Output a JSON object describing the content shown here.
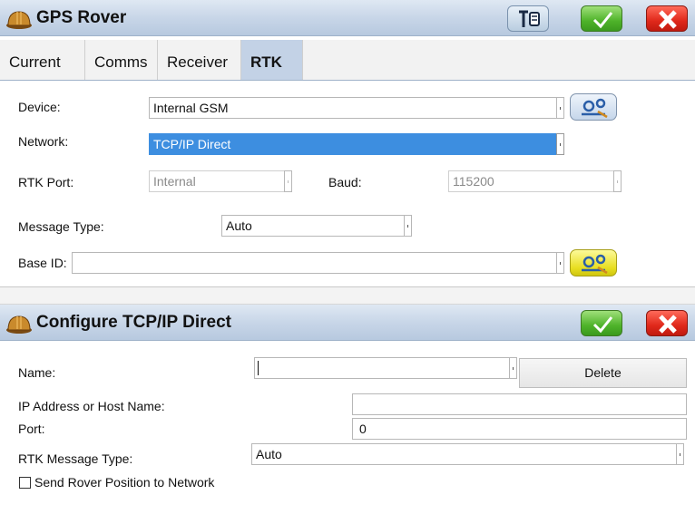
{
  "rover": {
    "title": "GPS Rover",
    "tabs": [
      "Current",
      "Comms",
      "Receiver",
      "RTK"
    ],
    "active_tab": "RTK",
    "device_label": "Device:",
    "device_value": "Internal GSM",
    "network_label": "Network:",
    "network_value": "TCP/IP Direct",
    "rtk_port_label": "RTK Port:",
    "rtk_port_value": "Internal",
    "baud_label": "Baud:",
    "baud_value": "115200",
    "message_type_label": "Message Type:",
    "message_type_value": "Auto",
    "base_id_label": "Base ID:",
    "base_id_value": ""
  },
  "config": {
    "title": "Configure TCP/IP Direct",
    "name_label": "Name:",
    "name_value": "",
    "delete_label": "Delete",
    "ip_label": "IP Address or Host Name:",
    "ip_value": "",
    "port_label": "Port:",
    "port_value": "0",
    "rtk_msg_label": "RTK Message Type:",
    "rtk_msg_value": "Auto",
    "send_position_label": "Send Rover Position to Network",
    "send_position_checked": false
  },
  "icons": {
    "app": "hard-hat-icon",
    "tool": "antenna-config-icon",
    "ok": "checkmark-icon",
    "cancel": "close-icon",
    "settings": "gears-settings-icon"
  },
  "colors": {
    "titlebar": "#c8d6e8",
    "active_tab": "#c3d2e6",
    "selection": "#3d8ee0",
    "ok_green": "#4fb32a",
    "cancel_red": "#e0281a",
    "settings_yellow": "#e8de21"
  }
}
